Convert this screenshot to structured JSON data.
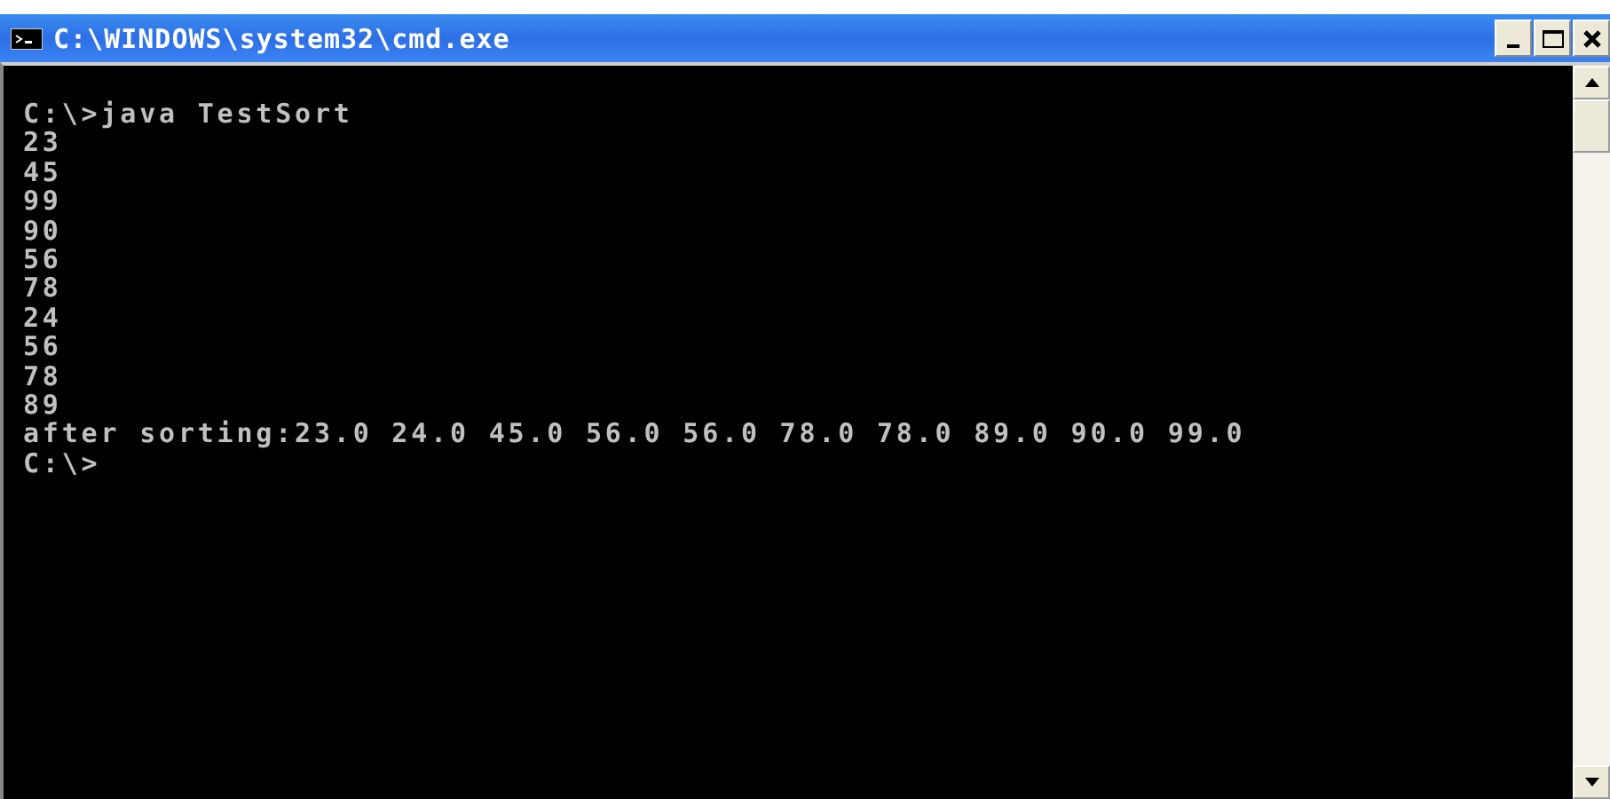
{
  "window": {
    "title": "C:\\WINDOWS\\system32\\cmd.exe"
  },
  "console": {
    "lines": [
      "C:\\>java TestSort",
      "23",
      "45",
      "99",
      "90",
      "56",
      "78",
      "24",
      "56",
      "78",
      "89",
      "after sorting:23.0 24.0 45.0 56.0 56.0 78.0 78.0 89.0 90.0 99.0",
      "C:\\>"
    ]
  }
}
